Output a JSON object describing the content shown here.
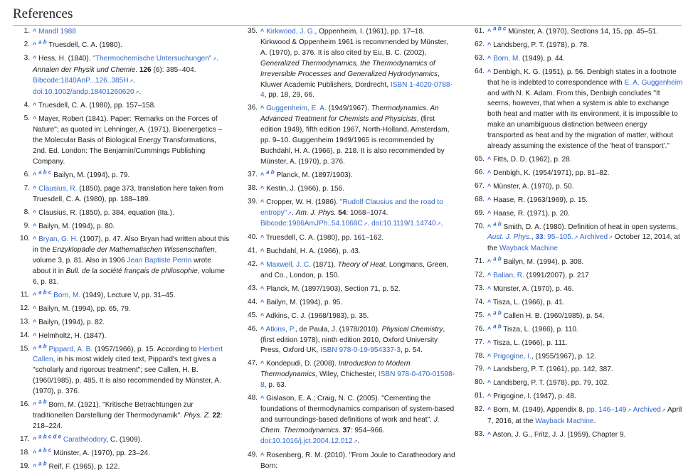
{
  "heading": "References",
  "col1": [
    {
      "n": "1.",
      "parts": [
        {
          "t": "^",
          "k": "car"
        },
        {
          "t": " "
        },
        {
          "t": "Mandl 1988",
          "k": "link"
        }
      ]
    },
    {
      "n": "2.",
      "parts": [
        {
          "t": "^",
          "k": "car"
        },
        {
          "t": " "
        },
        {
          "t": "a b",
          "k": "sup"
        },
        {
          "t": " Truesdell, C. A. (1980)."
        }
      ]
    },
    {
      "n": "3.",
      "parts": [
        {
          "t": "^",
          "k": "car"
        },
        {
          "t": " Hess, H. (1840). "
        },
        {
          "t": "\"Thermochemische Untersuchungen\"",
          "k": "ext"
        },
        {
          "t": ". "
        },
        {
          "t": "Annalen der Physik und Chemie",
          "k": "i"
        },
        {
          "t": ". "
        },
        {
          "t": "126",
          "k": "b"
        },
        {
          "t": " (6): 385–404. "
        },
        {
          "t": "Bibcode:1840AnP...126..385H",
          "k": "ext"
        },
        {
          "t": ". "
        },
        {
          "t": "doi:10.1002/andp.18401260620",
          "k": "ext"
        },
        {
          "t": "."
        }
      ]
    },
    {
      "n": "4.",
      "parts": [
        {
          "t": "^",
          "k": "car"
        },
        {
          "t": " Truesdell, C. A. (1980), pp. 157–158."
        }
      ]
    },
    {
      "n": "5.",
      "parts": [
        {
          "t": "^",
          "k": "car"
        },
        {
          "t": " Mayer, Robert (1841). Paper: 'Remarks on the Forces of Nature\"; as quoted in: Lehninger, A. (1971). Bioenergetics – the Molecular Basis of Biological Energy Transformations, 2nd. Ed. London: The Benjamin/Cummings Publishing Company."
        }
      ]
    },
    {
      "n": "6.",
      "parts": [
        {
          "t": "^",
          "k": "car"
        },
        {
          "t": " "
        },
        {
          "t": "a b c",
          "k": "sup"
        },
        {
          "t": " Bailyn, M. (1994), p. 79."
        }
      ]
    },
    {
      "n": "7.",
      "parts": [
        {
          "t": "^",
          "k": "car"
        },
        {
          "t": " "
        },
        {
          "t": "Clausius, R.",
          "k": "link"
        },
        {
          "t": " (1850), page 373, translation here taken from Truesdell, C. A. (1980), pp. 188–189."
        }
      ]
    },
    {
      "n": "8.",
      "parts": [
        {
          "t": "^",
          "k": "car"
        },
        {
          "t": " Clausius, R. (1850), p. 384, equation (IIa.)."
        }
      ]
    },
    {
      "n": "9.",
      "parts": [
        {
          "t": "^",
          "k": "car"
        },
        {
          "t": " Bailyn, M. (1994), p. 80."
        }
      ]
    },
    {
      "n": "10.",
      "parts": [
        {
          "t": "^",
          "k": "car"
        },
        {
          "t": " "
        },
        {
          "t": "Bryan, G. H.",
          "k": "link"
        },
        {
          "t": " (1907), p. 47. Also Bryan had written about this in the "
        },
        {
          "t": "Enzyklopädie der Mathematischen Wissenschaften",
          "k": "i"
        },
        {
          "t": ", volume 3, p. 81. Also in 1906 "
        },
        {
          "t": "Jean Baptiste Perrin",
          "k": "link"
        },
        {
          "t": " wrote about it in "
        },
        {
          "t": "Bull. de la société français de philosophie",
          "k": "i"
        },
        {
          "t": ", volume 6, p. 81."
        }
      ]
    },
    {
      "n": "11.",
      "parts": [
        {
          "t": "^",
          "k": "car"
        },
        {
          "t": " "
        },
        {
          "t": "a b c",
          "k": "sup"
        },
        {
          "t": " "
        },
        {
          "t": "Born, M.",
          "k": "link"
        },
        {
          "t": " (1949), Lecture V, pp. 31–45."
        }
      ]
    },
    {
      "n": "12.",
      "parts": [
        {
          "t": "^",
          "k": "car"
        },
        {
          "t": " Bailyn, M. (1994), pp. 65, 79."
        }
      ]
    },
    {
      "n": "13.",
      "parts": [
        {
          "t": "^",
          "k": "car"
        },
        {
          "t": " Bailyn, (1994), p. 82."
        }
      ]
    },
    {
      "n": "14.",
      "parts": [
        {
          "t": "^",
          "k": "car"
        },
        {
          "t": " Helmholtz, H. (1847)."
        }
      ]
    },
    {
      "n": "15.",
      "parts": [
        {
          "t": "^",
          "k": "car"
        },
        {
          "t": " "
        },
        {
          "t": "a b",
          "k": "sup"
        },
        {
          "t": " "
        },
        {
          "t": "Pippard, A. B.",
          "k": "link"
        },
        {
          "t": " (1957/1966), p. 15. According to "
        },
        {
          "t": "Herbert Callen",
          "k": "link"
        },
        {
          "t": ", in his most widely cited text, Pippard's text gives a \"scholarly and rigorous treatment\"; see Callen, H. B. (1960/1985), p. 485. It is also recommended by Münster, A. (1970), p. 376."
        }
      ]
    },
    {
      "n": "16.",
      "parts": [
        {
          "t": "^",
          "k": "car"
        },
        {
          "t": " "
        },
        {
          "t": "a b",
          "k": "sup"
        },
        {
          "t": " Born, M. (1921). \"Kritische Betrachtungen zur traditionellen Darstellung der Thermodynamik\". "
        },
        {
          "t": "Phys. Z.",
          "k": "i"
        },
        {
          "t": " "
        },
        {
          "t": "22",
          "k": "b"
        },
        {
          "t": ": 218–224."
        }
      ]
    },
    {
      "n": "17.",
      "parts": [
        {
          "t": "^",
          "k": "car"
        },
        {
          "t": " "
        },
        {
          "t": "a b c d e",
          "k": "sup"
        },
        {
          "t": " "
        },
        {
          "t": "Carathéodory",
          "k": "link"
        },
        {
          "t": ", C. (1909)."
        }
      ]
    },
    {
      "n": "18.",
      "parts": [
        {
          "t": "^",
          "k": "car"
        },
        {
          "t": " "
        },
        {
          "t": "a b c",
          "k": "sup"
        },
        {
          "t": " Münster, A. (1970), pp. 23–24."
        }
      ]
    },
    {
      "n": "19.",
      "parts": [
        {
          "t": "^",
          "k": "car"
        },
        {
          "t": " "
        },
        {
          "t": "a b",
          "k": "sup"
        },
        {
          "t": " Reif, F. (1965), p. 122."
        }
      ]
    }
  ],
  "col2": [
    {
      "n": "35.",
      "parts": [
        {
          "t": "^",
          "k": "car"
        },
        {
          "t": " "
        },
        {
          "t": "Kirkwood, J. G.",
          "k": "link"
        },
        {
          "t": ", Oppenheim, I. (1961), pp. 17–18. Kirkwood & Oppenheim 1961 is recommended by Münster, A. (1970), p. 376. It is also cited by Eu, B. C. (2002), "
        },
        {
          "t": "Generalized Thermodynamics, the Thermodynamics of Irreversible Processes and Generalized Hydrodynamics",
          "k": "i"
        },
        {
          "t": ", Kluwer Academic Publishers, Dordrecht, "
        },
        {
          "t": "ISBN 1-4020-0788-4",
          "k": "link"
        },
        {
          "t": ", pp. 18, 29, 66."
        }
      ]
    },
    {
      "n": "36.",
      "parts": [
        {
          "t": "^",
          "k": "car"
        },
        {
          "t": " "
        },
        {
          "t": "Guggenheim, E. A.",
          "k": "link"
        },
        {
          "t": " (1949/1967). "
        },
        {
          "t": "Thermodynamics. An Advanced Treatment for Chemists and Physicists",
          "k": "i"
        },
        {
          "t": ", (first edition 1949), fifth edition 1967, North-Holland, Amsterdam, pp. 9–10. Guggenheim 1949/1965 is recommended by Buchdahl, H. A. (1966), p. 218. It is also recommended by Münster, A. (1970), p. 376."
        }
      ]
    },
    {
      "n": "37.",
      "parts": [
        {
          "t": "^",
          "k": "car"
        },
        {
          "t": " "
        },
        {
          "t": "a b",
          "k": "sup"
        },
        {
          "t": " Planck, M. (1897/1903)."
        }
      ]
    },
    {
      "n": "38.",
      "parts": [
        {
          "t": "^",
          "k": "car"
        },
        {
          "t": " Kestin, J. (1966), p. 156."
        }
      ]
    },
    {
      "n": "39.",
      "parts": [
        {
          "t": "^",
          "k": "car"
        },
        {
          "t": " Cropper, W. H. (1986). "
        },
        {
          "t": "\"Rudolf Clausius and the road to entropy\"",
          "k": "ext"
        },
        {
          "t": ". "
        },
        {
          "t": "Am. J. Phys.",
          "k": "i"
        },
        {
          "t": " "
        },
        {
          "t": "54",
          "k": "b"
        },
        {
          "t": ": 1068–1074. "
        },
        {
          "t": "Bibcode:1986AmJPh..54.1068C",
          "k": "ext"
        },
        {
          "t": ". "
        },
        {
          "t": "doi:10.1119/1.14740",
          "k": "ext"
        },
        {
          "t": "."
        }
      ]
    },
    {
      "n": "40.",
      "parts": [
        {
          "t": "^",
          "k": "car"
        },
        {
          "t": " Truesdell, C. A. (1980), pp. 161–162."
        }
      ]
    },
    {
      "n": "41.",
      "parts": [
        {
          "t": "^",
          "k": "car"
        },
        {
          "t": " Buchdahl, H. A. (1966), p. 43."
        }
      ]
    },
    {
      "n": "42.",
      "parts": [
        {
          "t": "^",
          "k": "car"
        },
        {
          "t": " "
        },
        {
          "t": "Maxwell, J. C.",
          "k": "link"
        },
        {
          "t": " (1871). "
        },
        {
          "t": "Theory of Heat",
          "k": "i"
        },
        {
          "t": ", Longmans, Green, and Co., London, p. 150."
        }
      ]
    },
    {
      "n": "43.",
      "parts": [
        {
          "t": "^",
          "k": "car"
        },
        {
          "t": " Planck, M. (1897/1903), Section 71, p. 52."
        }
      ]
    },
    {
      "n": "44.",
      "parts": [
        {
          "t": "^",
          "k": "car"
        },
        {
          "t": " Bailyn, M. (1994), p. 95."
        }
      ]
    },
    {
      "n": "45.",
      "parts": [
        {
          "t": "^",
          "k": "car"
        },
        {
          "t": " Adkins, C. J. (1968/1983), p. 35."
        }
      ]
    },
    {
      "n": "46.",
      "parts": [
        {
          "t": "^",
          "k": "car"
        },
        {
          "t": " "
        },
        {
          "t": "Atkins, P.",
          "k": "link"
        },
        {
          "t": ", de Paula, J. (1978/2010). "
        },
        {
          "t": "Physical Chemistry",
          "k": "i"
        },
        {
          "t": ", (first edition 1978), ninth edition 2010, Oxford University Press, Oxford UK, "
        },
        {
          "t": "ISBN 978-0-19-954337-3",
          "k": "link"
        },
        {
          "t": ", p. 54."
        }
      ]
    },
    {
      "n": "47.",
      "parts": [
        {
          "t": "^",
          "k": "car"
        },
        {
          "t": " Kondepudi, D. (2008). "
        },
        {
          "t": "Introduction to Modern Thermodynamics",
          "k": "i"
        },
        {
          "t": ", Wiley, Chichester, "
        },
        {
          "t": "ISBN 978-0-470-01598-8",
          "k": "link"
        },
        {
          "t": ", p. 63."
        }
      ]
    },
    {
      "n": "48.",
      "parts": [
        {
          "t": "^",
          "k": "car"
        },
        {
          "t": " Gislason, E. A.; Craig, N. C. (2005). \"Cementing the foundations of thermodynamics comparison of system-based and surroundings-based definitions of work and heat\". "
        },
        {
          "t": "J. Chem. Thermodynamics",
          "k": "i"
        },
        {
          "t": ". "
        },
        {
          "t": "37",
          "k": "b"
        },
        {
          "t": ": 954–966. "
        },
        {
          "t": "doi:10.1016/j.jct.2004.12.012",
          "k": "ext"
        },
        {
          "t": "."
        }
      ]
    },
    {
      "n": "49.",
      "parts": [
        {
          "t": "^",
          "k": "car"
        },
        {
          "t": " Rosenberg, R. M. (2010). \"From Joule to Caratheodory and Born:"
        }
      ]
    }
  ],
  "col3": [
    {
      "n": "61.",
      "parts": [
        {
          "t": "^",
          "k": "car"
        },
        {
          "t": " "
        },
        {
          "t": "a b c",
          "k": "sup"
        },
        {
          "t": " Münster, A. (1970), Sections 14, 15, pp. 45–51."
        }
      ]
    },
    {
      "n": "62.",
      "parts": [
        {
          "t": "^",
          "k": "car"
        },
        {
          "t": " Landsberg, P. T. (1978), p. 78."
        }
      ]
    },
    {
      "n": "63.",
      "parts": [
        {
          "t": "^",
          "k": "car"
        },
        {
          "t": " "
        },
        {
          "t": "Born, M.",
          "k": "link"
        },
        {
          "t": " (1949), p. 44."
        }
      ]
    },
    {
      "n": "64.",
      "parts": [
        {
          "t": "^",
          "k": "car"
        },
        {
          "t": " Denbigh, K. G. (1951), p. 56. Denbigh states in a footnote that he is indebted to correspondence with "
        },
        {
          "t": "E. A. Guggenheim",
          "k": "link"
        },
        {
          "t": " and with N. K. Adam. From this, Denbigh concludes \"It seems, however, that when a system is able to exchange both heat and matter with its environment, it is impossible to make an unambiguous distinction between energy transported as heat and by the migration of matter, without already assuming the existence of the 'heat of transport'.\""
        }
      ]
    },
    {
      "n": "65.",
      "parts": [
        {
          "t": "^",
          "k": "car"
        },
        {
          "t": " Fitts, D. D. (1962), p. 28."
        }
      ]
    },
    {
      "n": "66.",
      "parts": [
        {
          "t": "^",
          "k": "car"
        },
        {
          "t": " Denbigh, K. (1954/1971), pp. 81–82."
        }
      ]
    },
    {
      "n": "67.",
      "parts": [
        {
          "t": "^",
          "k": "car"
        },
        {
          "t": " Münster, A. (1970), p. 50."
        }
      ]
    },
    {
      "n": "68.",
      "parts": [
        {
          "t": "^",
          "k": "car"
        },
        {
          "t": " Haase, R. (1963/1969), p. 15."
        }
      ]
    },
    {
      "n": "69.",
      "parts": [
        {
          "t": "^",
          "k": "car"
        },
        {
          "t": " Haase, R. (1971), p. 20."
        }
      ]
    },
    {
      "n": "70.",
      "parts": [
        {
          "t": "^",
          "k": "car"
        },
        {
          "t": " "
        },
        {
          "t": "a b",
          "k": "sup"
        },
        {
          "t": " Smith, D. A. (1980). Definition of heat in open systems, "
        },
        {
          "t": "Aust. J. Phys.",
          "k": "ilink"
        },
        {
          "t": ", "
        },
        {
          "t": "33",
          "k": "blink"
        },
        {
          "t": ": 95–105.",
          "k": "ext"
        },
        {
          "t": " "
        },
        {
          "t": "Archived",
          "k": "ext"
        },
        {
          "t": " October 12, 2014, at the "
        },
        {
          "t": "Wayback Machine",
          "k": "link"
        }
      ]
    },
    {
      "n": "71.",
      "parts": [
        {
          "t": "^",
          "k": "car"
        },
        {
          "t": " "
        },
        {
          "t": "a b",
          "k": "sup"
        },
        {
          "t": " Bailyn, M. (1994), p. 308."
        }
      ]
    },
    {
      "n": "72.",
      "parts": [
        {
          "t": "^",
          "k": "car"
        },
        {
          "t": " "
        },
        {
          "t": "Balian, R.",
          "k": "link"
        },
        {
          "t": " (1991/2007), p. 217"
        }
      ]
    },
    {
      "n": "73.",
      "parts": [
        {
          "t": "^",
          "k": "car"
        },
        {
          "t": " Münster, A. (1970), p. 46."
        }
      ]
    },
    {
      "n": "74.",
      "parts": [
        {
          "t": "^",
          "k": "car"
        },
        {
          "t": " Tisza, L. (1966), p. 41."
        }
      ]
    },
    {
      "n": "75.",
      "parts": [
        {
          "t": "^",
          "k": "car"
        },
        {
          "t": " "
        },
        {
          "t": "a b",
          "k": "sup"
        },
        {
          "t": " Callen H. B. (1960/1985), p. 54."
        }
      ]
    },
    {
      "n": "76.",
      "parts": [
        {
          "t": "^",
          "k": "car"
        },
        {
          "t": " "
        },
        {
          "t": "a b",
          "k": "sup"
        },
        {
          "t": " Tisza, L. (1966), p. 110."
        }
      ]
    },
    {
      "n": "77.",
      "parts": [
        {
          "t": "^",
          "k": "car"
        },
        {
          "t": " Tisza, L. (1966), p. 111."
        }
      ]
    },
    {
      "n": "78.",
      "parts": [
        {
          "t": "^",
          "k": "car"
        },
        {
          "t": " "
        },
        {
          "t": "Prigogine, I.",
          "k": "link"
        },
        {
          "t": ", (1955/1967), p. 12."
        }
      ]
    },
    {
      "n": "79.",
      "parts": [
        {
          "t": "^",
          "k": "car"
        },
        {
          "t": " Landsberg, P. T. (1961), pp. 142, 387."
        }
      ]
    },
    {
      "n": "80.",
      "parts": [
        {
          "t": "^",
          "k": "car"
        },
        {
          "t": " Landsberg, P. T. (1978), pp. 79, 102."
        }
      ]
    },
    {
      "n": "81.",
      "parts": [
        {
          "t": "^",
          "k": "car"
        },
        {
          "t": " Prigogine, I. (1947), p. 48."
        }
      ]
    },
    {
      "n": "82.",
      "parts": [
        {
          "t": "^",
          "k": "car"
        },
        {
          "t": " Born, M. (1949), Appendix 8, "
        },
        {
          "t": "pp. 146–149",
          "k": "ext"
        },
        {
          "t": " "
        },
        {
          "t": "Archived",
          "k": "ext"
        },
        {
          "t": " April 7, 2016, at the "
        },
        {
          "t": "Wayback Machine",
          "k": "link"
        },
        {
          "t": "."
        }
      ]
    },
    {
      "n": "83.",
      "parts": [
        {
          "t": "^",
          "k": "car"
        },
        {
          "t": " Aston, J. G., Fritz, J. J. (1959), Chapter 9."
        }
      ]
    }
  ]
}
